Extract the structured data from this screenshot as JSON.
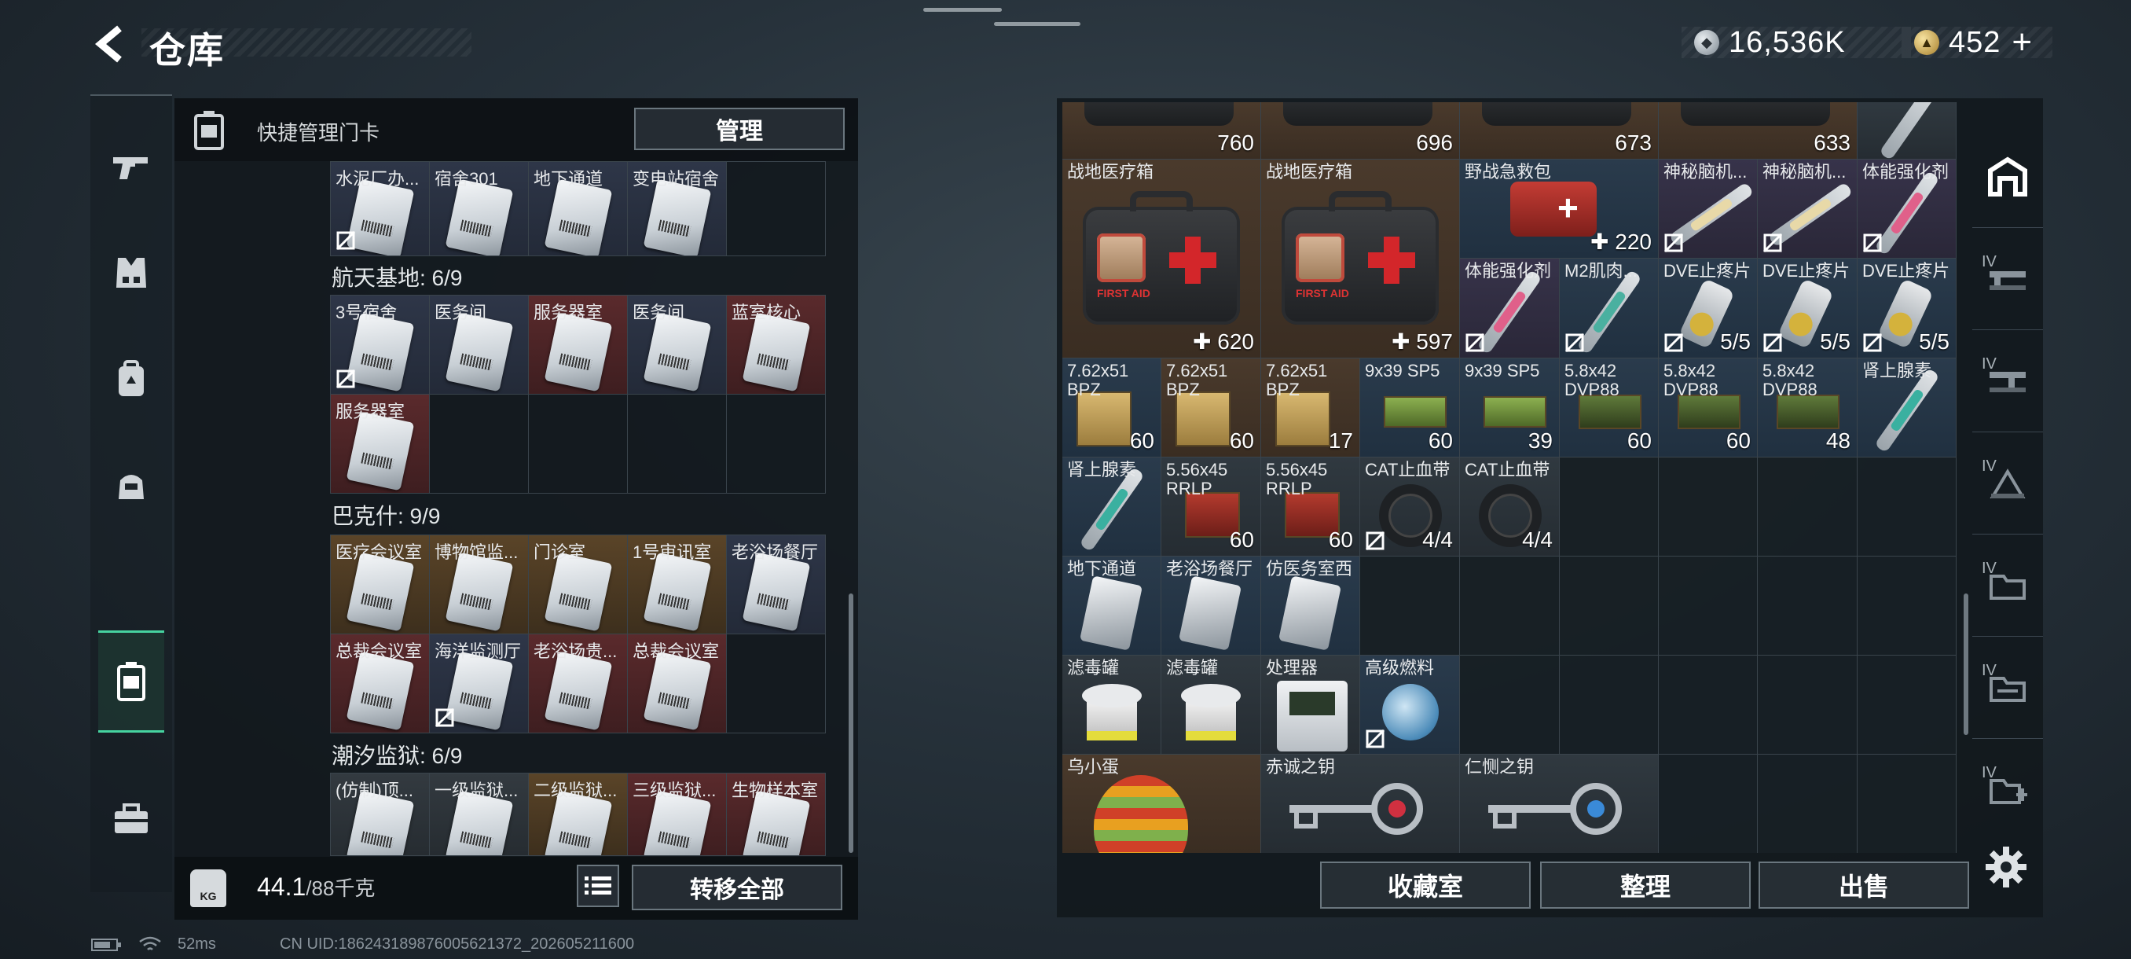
{
  "header": {
    "title": "仓库",
    "currency_silver": "16,536K",
    "currency_gold": "452",
    "plus": "+"
  },
  "left_rail": {
    "items": [
      "weapon-icon",
      "armor-icon",
      "backpack-icon",
      "pouch-icon",
      "keycard-icon",
      "toolbox-icon"
    ],
    "active": "keycard-icon"
  },
  "keycard_panel": {
    "header_label": "快捷管理门卡",
    "manage_button": "管理",
    "groups": [
      {
        "title": "",
        "cards": [
          {
            "name": "水泥厂办...",
            "color": "blue",
            "no_bind": true
          },
          {
            "name": "宿舍301",
            "color": "blue",
            "no_bind": false
          },
          {
            "name": "地下通道",
            "color": "blue",
            "no_bind": false
          },
          {
            "name": "变电站宿舍",
            "color": "blue",
            "no_bind": false
          }
        ]
      },
      {
        "title": "航天基地: 6/9",
        "cards": [
          {
            "name": "3号宿舍",
            "color": "blue",
            "no_bind": true
          },
          {
            "name": "医务间",
            "color": "blue",
            "no_bind": false
          },
          {
            "name": "服务器室",
            "color": "red",
            "no_bind": false
          },
          {
            "name": "医务间",
            "color": "blue",
            "no_bind": false
          },
          {
            "name": "蓝室核心",
            "color": "red",
            "no_bind": false
          },
          {
            "name": "服务器室",
            "color": "red",
            "no_bind": false
          }
        ]
      },
      {
        "title": "巴克什: 9/9",
        "cards": [
          {
            "name": "医疗会议室",
            "color": "gold",
            "no_bind": false
          },
          {
            "name": "博物馆监...",
            "color": "gold",
            "no_bind": false
          },
          {
            "name": "门诊室",
            "color": "gold",
            "no_bind": false
          },
          {
            "name": "1号审讯室",
            "color": "gold",
            "no_bind": false
          },
          {
            "name": "老浴场餐厅",
            "color": "blue",
            "no_bind": false
          },
          {
            "name": "总裁会议室",
            "color": "red",
            "no_bind": false
          },
          {
            "name": "海洋监测厅",
            "color": "blue",
            "no_bind": true
          },
          {
            "name": "老浴场贵...",
            "color": "red",
            "no_bind": false
          },
          {
            "name": "总裁会议室",
            "color": "red",
            "no_bind": false
          }
        ]
      },
      {
        "title": "潮汐监狱: 6/9",
        "cards": [
          {
            "name": "(仿制)顶...",
            "color": "gray",
            "no_bind": false
          },
          {
            "name": "一级监狱...",
            "color": "gray",
            "no_bind": false
          },
          {
            "name": "二级监狱...",
            "color": "gold",
            "no_bind": false
          },
          {
            "name": "三级监狱...",
            "color": "red",
            "no_bind": false
          },
          {
            "name": "生物样本室",
            "color": "red",
            "no_bind": false
          }
        ]
      }
    ],
    "weight_badge": "KG",
    "weight_value": "44.1",
    "weight_capacity": "/88千克",
    "move_all_button": "转移全部"
  },
  "storage": {
    "row0_counts": [
      "760",
      "696",
      "673",
      "633"
    ],
    "items": {
      "medkit1": {
        "name": "战地医疗箱",
        "count": "620",
        "label": "FIRST AID"
      },
      "medkit2": {
        "name": "战地医疗箱",
        "count": "597",
        "label": "FIRST AID"
      },
      "fieldkit": {
        "name": "野战急救包",
        "count": "220"
      },
      "brain1": {
        "name": "神秘脑机..."
      },
      "brain2": {
        "name": "神秘脑机..."
      },
      "stim1": {
        "name": "体能强化剂"
      },
      "stim2": {
        "name": "体能强化剂"
      },
      "m2": {
        "name": "M2肌肉..."
      },
      "dve1": {
        "name": "DVE止疼片",
        "count": "5/5"
      },
      "dve2": {
        "name": "DVE止疼片",
        "count": "5/5"
      },
      "dve3": {
        "name": "DVE止疼片",
        "count": "5/5"
      },
      "a1": {
        "name": "7.62x51 BPZ",
        "count": "60"
      },
      "a2": {
        "name": "7.62x51 BPZ",
        "count": "60"
      },
      "a3": {
        "name": "7.62x51 BPZ",
        "count": "17"
      },
      "a4": {
        "name": "9x39 SP5",
        "count": "60"
      },
      "a5": {
        "name": "9x39 SP5",
        "count": "39"
      },
      "a6": {
        "name": "5.8x42 DVP88",
        "count": "60"
      },
      "a7": {
        "name": "5.8x42 DVP88",
        "count": "60"
      },
      "a8": {
        "name": "5.8x42 DVP88",
        "count": "48"
      },
      "adr1": {
        "name": "肾上腺素"
      },
      "adr2": {
        "name": "肾上腺素"
      },
      "rr1": {
        "name": "5.56x45 RRLP",
        "count": "60"
      },
      "rr2": {
        "name": "5.56x45 RRLP",
        "count": "60"
      },
      "cat1": {
        "name": "CAT止血带",
        "count": "4/4"
      },
      "cat2": {
        "name": "CAT止血带",
        "count": "4/4"
      },
      "k1": {
        "name": "地下通道"
      },
      "k2": {
        "name": "老浴场餐厅"
      },
      "k3": {
        "name": "仿医务室西"
      },
      "f1": {
        "name": "滤毒罐"
      },
      "f2": {
        "name": "滤毒罐"
      },
      "proc": {
        "name": "处理器"
      },
      "fuel": {
        "name": "高级燃料"
      },
      "egg": {
        "name": "乌小蛋"
      },
      "key1": {
        "name": "赤诚之钥"
      },
      "key2": {
        "name": "仁恻之钥"
      }
    },
    "buttons": {
      "collection": "收藏室",
      "sort": "整理",
      "sell": "出售"
    }
  },
  "right_rail": {
    "tabs": [
      "IV",
      "IV",
      "IV",
      "IV",
      "IV",
      "IV"
    ]
  },
  "status_bar": {
    "ping": "52ms",
    "uid": "CN UID:1862431898760056213​72_202605211600"
  },
  "colors": {
    "accent_green": "#46d3a0",
    "card_red": "#5a2a2c",
    "card_gold": "#5a4428",
    "card_blue": "#2e3648"
  }
}
